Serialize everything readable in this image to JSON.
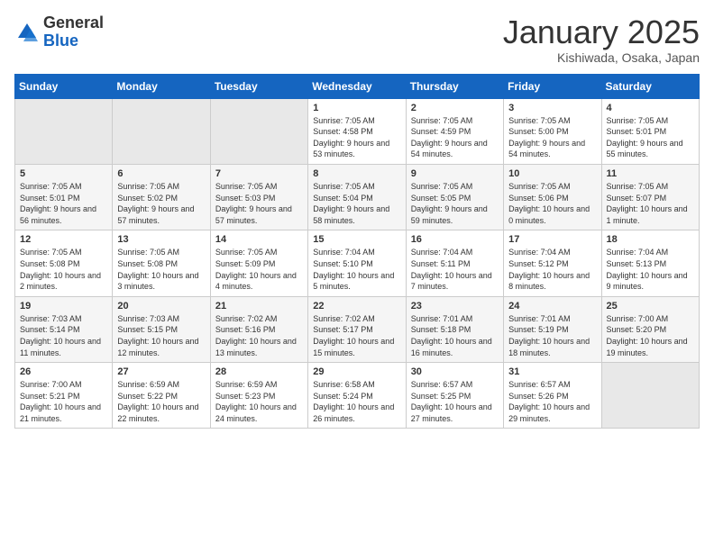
{
  "header": {
    "logo_general": "General",
    "logo_blue": "Blue",
    "title": "January 2025",
    "subtitle": "Kishiwada, Osaka, Japan"
  },
  "columns": [
    "Sunday",
    "Monday",
    "Tuesday",
    "Wednesday",
    "Thursday",
    "Friday",
    "Saturday"
  ],
  "weeks": [
    [
      {
        "day": "",
        "sunrise": "",
        "sunset": "",
        "daylight": ""
      },
      {
        "day": "",
        "sunrise": "",
        "sunset": "",
        "daylight": ""
      },
      {
        "day": "",
        "sunrise": "",
        "sunset": "",
        "daylight": ""
      },
      {
        "day": "1",
        "sunrise": "Sunrise: 7:05 AM",
        "sunset": "Sunset: 4:58 PM",
        "daylight": "Daylight: 9 hours and 53 minutes."
      },
      {
        "day": "2",
        "sunrise": "Sunrise: 7:05 AM",
        "sunset": "Sunset: 4:59 PM",
        "daylight": "Daylight: 9 hours and 54 minutes."
      },
      {
        "day": "3",
        "sunrise": "Sunrise: 7:05 AM",
        "sunset": "Sunset: 5:00 PM",
        "daylight": "Daylight: 9 hours and 54 minutes."
      },
      {
        "day": "4",
        "sunrise": "Sunrise: 7:05 AM",
        "sunset": "Sunset: 5:01 PM",
        "daylight": "Daylight: 9 hours and 55 minutes."
      }
    ],
    [
      {
        "day": "5",
        "sunrise": "Sunrise: 7:05 AM",
        "sunset": "Sunset: 5:01 PM",
        "daylight": "Daylight: 9 hours and 56 minutes."
      },
      {
        "day": "6",
        "sunrise": "Sunrise: 7:05 AM",
        "sunset": "Sunset: 5:02 PM",
        "daylight": "Daylight: 9 hours and 57 minutes."
      },
      {
        "day": "7",
        "sunrise": "Sunrise: 7:05 AM",
        "sunset": "Sunset: 5:03 PM",
        "daylight": "Daylight: 9 hours and 57 minutes."
      },
      {
        "day": "8",
        "sunrise": "Sunrise: 7:05 AM",
        "sunset": "Sunset: 5:04 PM",
        "daylight": "Daylight: 9 hours and 58 minutes."
      },
      {
        "day": "9",
        "sunrise": "Sunrise: 7:05 AM",
        "sunset": "Sunset: 5:05 PM",
        "daylight": "Daylight: 9 hours and 59 minutes."
      },
      {
        "day": "10",
        "sunrise": "Sunrise: 7:05 AM",
        "sunset": "Sunset: 5:06 PM",
        "daylight": "Daylight: 10 hours and 0 minutes."
      },
      {
        "day": "11",
        "sunrise": "Sunrise: 7:05 AM",
        "sunset": "Sunset: 5:07 PM",
        "daylight": "Daylight: 10 hours and 1 minute."
      }
    ],
    [
      {
        "day": "12",
        "sunrise": "Sunrise: 7:05 AM",
        "sunset": "Sunset: 5:08 PM",
        "daylight": "Daylight: 10 hours and 2 minutes."
      },
      {
        "day": "13",
        "sunrise": "Sunrise: 7:05 AM",
        "sunset": "Sunset: 5:08 PM",
        "daylight": "Daylight: 10 hours and 3 minutes."
      },
      {
        "day": "14",
        "sunrise": "Sunrise: 7:05 AM",
        "sunset": "Sunset: 5:09 PM",
        "daylight": "Daylight: 10 hours and 4 minutes."
      },
      {
        "day": "15",
        "sunrise": "Sunrise: 7:04 AM",
        "sunset": "Sunset: 5:10 PM",
        "daylight": "Daylight: 10 hours and 5 minutes."
      },
      {
        "day": "16",
        "sunrise": "Sunrise: 7:04 AM",
        "sunset": "Sunset: 5:11 PM",
        "daylight": "Daylight: 10 hours and 7 minutes."
      },
      {
        "day": "17",
        "sunrise": "Sunrise: 7:04 AM",
        "sunset": "Sunset: 5:12 PM",
        "daylight": "Daylight: 10 hours and 8 minutes."
      },
      {
        "day": "18",
        "sunrise": "Sunrise: 7:04 AM",
        "sunset": "Sunset: 5:13 PM",
        "daylight": "Daylight: 10 hours and 9 minutes."
      }
    ],
    [
      {
        "day": "19",
        "sunrise": "Sunrise: 7:03 AM",
        "sunset": "Sunset: 5:14 PM",
        "daylight": "Daylight: 10 hours and 11 minutes."
      },
      {
        "day": "20",
        "sunrise": "Sunrise: 7:03 AM",
        "sunset": "Sunset: 5:15 PM",
        "daylight": "Daylight: 10 hours and 12 minutes."
      },
      {
        "day": "21",
        "sunrise": "Sunrise: 7:02 AM",
        "sunset": "Sunset: 5:16 PM",
        "daylight": "Daylight: 10 hours and 13 minutes."
      },
      {
        "day": "22",
        "sunrise": "Sunrise: 7:02 AM",
        "sunset": "Sunset: 5:17 PM",
        "daylight": "Daylight: 10 hours and 15 minutes."
      },
      {
        "day": "23",
        "sunrise": "Sunrise: 7:01 AM",
        "sunset": "Sunset: 5:18 PM",
        "daylight": "Daylight: 10 hours and 16 minutes."
      },
      {
        "day": "24",
        "sunrise": "Sunrise: 7:01 AM",
        "sunset": "Sunset: 5:19 PM",
        "daylight": "Daylight: 10 hours and 18 minutes."
      },
      {
        "day": "25",
        "sunrise": "Sunrise: 7:00 AM",
        "sunset": "Sunset: 5:20 PM",
        "daylight": "Daylight: 10 hours and 19 minutes."
      }
    ],
    [
      {
        "day": "26",
        "sunrise": "Sunrise: 7:00 AM",
        "sunset": "Sunset: 5:21 PM",
        "daylight": "Daylight: 10 hours and 21 minutes."
      },
      {
        "day": "27",
        "sunrise": "Sunrise: 6:59 AM",
        "sunset": "Sunset: 5:22 PM",
        "daylight": "Daylight: 10 hours and 22 minutes."
      },
      {
        "day": "28",
        "sunrise": "Sunrise: 6:59 AM",
        "sunset": "Sunset: 5:23 PM",
        "daylight": "Daylight: 10 hours and 24 minutes."
      },
      {
        "day": "29",
        "sunrise": "Sunrise: 6:58 AM",
        "sunset": "Sunset: 5:24 PM",
        "daylight": "Daylight: 10 hours and 26 minutes."
      },
      {
        "day": "30",
        "sunrise": "Sunrise: 6:57 AM",
        "sunset": "Sunset: 5:25 PM",
        "daylight": "Daylight: 10 hours and 27 minutes."
      },
      {
        "day": "31",
        "sunrise": "Sunrise: 6:57 AM",
        "sunset": "Sunset: 5:26 PM",
        "daylight": "Daylight: 10 hours and 29 minutes."
      },
      {
        "day": "",
        "sunrise": "",
        "sunset": "",
        "daylight": ""
      }
    ]
  ]
}
